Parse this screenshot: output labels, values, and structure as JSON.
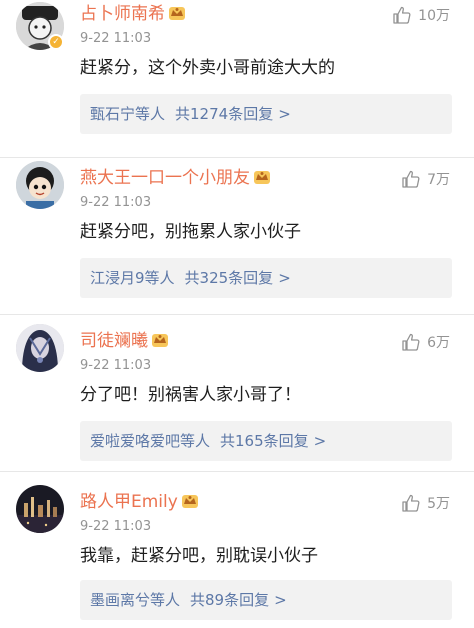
{
  "comments": [
    {
      "username": "占卜师南希",
      "time": "9-22 11:03",
      "likes": "10万",
      "text": "赶紧分，这个外卖小哥前途大大的",
      "reply_users": "甄石宁等人",
      "reply_count": "共1274条回复",
      "verified": true
    },
    {
      "username": "燕大王一口一个小朋友",
      "time": "9-22 11:03",
      "likes": "7万",
      "text": "赶紧分吧，别拖累人家小伙子",
      "reply_users": "江浸月9等人",
      "reply_count": "共325条回复",
      "verified": false
    },
    {
      "username": "司徒斓曦",
      "time": "9-22 11:03",
      "likes": "6万",
      "text": "分了吧！别祸害人家小哥了！",
      "reply_users": "爱啦爱咯爱吧等人",
      "reply_count": "共165条回复",
      "verified": false
    },
    {
      "username": "路人甲Emily",
      "time": "9-22 11:03",
      "likes": "5万",
      "text": "我靠，赶紧分吧，别耽误小伙子",
      "reply_users": "墨画离兮等人",
      "reply_count": "共89条回复",
      "verified": false
    }
  ],
  "reply_chevron": ">",
  "colors": {
    "username": "#eb7350",
    "reply_link": "#5d78a7",
    "meta_gray": "#939393",
    "reply_bg": "#f2f2f2",
    "vip_gold": "#f0a830"
  },
  "icons": {
    "like": "thumbs-up-icon",
    "vip": "vip-crown-icon",
    "verified": "verified-badge-icon"
  }
}
